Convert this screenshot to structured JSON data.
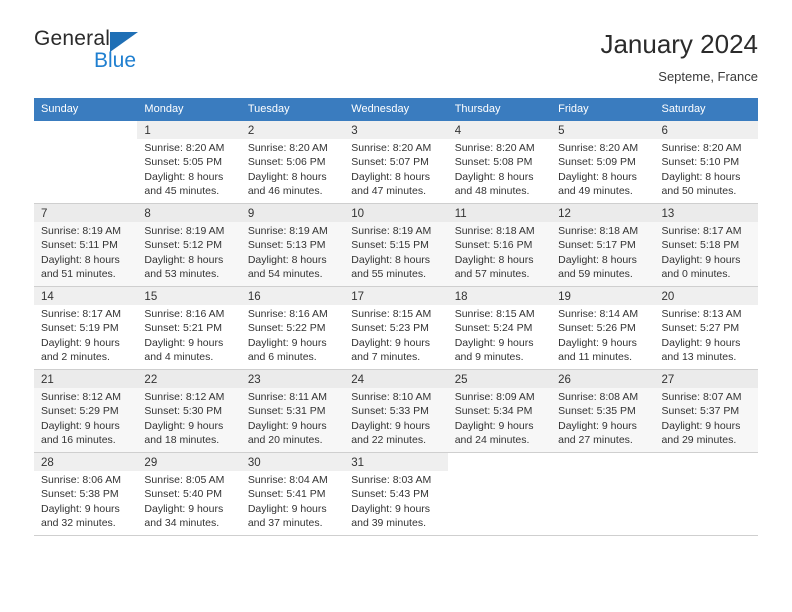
{
  "brand": {
    "name_part1": "General",
    "name_part2": "Blue",
    "accent_color": "#1f7fd0",
    "triangle_color": "#1f6fb5"
  },
  "header": {
    "title": "January 2024",
    "subtitle": "Septeme, France",
    "header_bg_color": "#3a7cbf"
  },
  "weekdays": [
    "Sunday",
    "Monday",
    "Tuesday",
    "Wednesday",
    "Thursday",
    "Friday",
    "Saturday"
  ],
  "weeks": [
    [
      {
        "day": "",
        "l1": "",
        "l2": "",
        "l3": "",
        "l4": ""
      },
      {
        "day": "1",
        "l1": "Sunrise: 8:20 AM",
        "l2": "Sunset: 5:05 PM",
        "l3": "Daylight: 8 hours",
        "l4": "and 45 minutes."
      },
      {
        "day": "2",
        "l1": "Sunrise: 8:20 AM",
        "l2": "Sunset: 5:06 PM",
        "l3": "Daylight: 8 hours",
        "l4": "and 46 minutes."
      },
      {
        "day": "3",
        "l1": "Sunrise: 8:20 AM",
        "l2": "Sunset: 5:07 PM",
        "l3": "Daylight: 8 hours",
        "l4": "and 47 minutes."
      },
      {
        "day": "4",
        "l1": "Sunrise: 8:20 AM",
        "l2": "Sunset: 5:08 PM",
        "l3": "Daylight: 8 hours",
        "l4": "and 48 minutes."
      },
      {
        "day": "5",
        "l1": "Sunrise: 8:20 AM",
        "l2": "Sunset: 5:09 PM",
        "l3": "Daylight: 8 hours",
        "l4": "and 49 minutes."
      },
      {
        "day": "6",
        "l1": "Sunrise: 8:20 AM",
        "l2": "Sunset: 5:10 PM",
        "l3": "Daylight: 8 hours",
        "l4": "and 50 minutes."
      }
    ],
    [
      {
        "day": "7",
        "l1": "Sunrise: 8:19 AM",
        "l2": "Sunset: 5:11 PM",
        "l3": "Daylight: 8 hours",
        "l4": "and 51 minutes."
      },
      {
        "day": "8",
        "l1": "Sunrise: 8:19 AM",
        "l2": "Sunset: 5:12 PM",
        "l3": "Daylight: 8 hours",
        "l4": "and 53 minutes."
      },
      {
        "day": "9",
        "l1": "Sunrise: 8:19 AM",
        "l2": "Sunset: 5:13 PM",
        "l3": "Daylight: 8 hours",
        "l4": "and 54 minutes."
      },
      {
        "day": "10",
        "l1": "Sunrise: 8:19 AM",
        "l2": "Sunset: 5:15 PM",
        "l3": "Daylight: 8 hours",
        "l4": "and 55 minutes."
      },
      {
        "day": "11",
        "l1": "Sunrise: 8:18 AM",
        "l2": "Sunset: 5:16 PM",
        "l3": "Daylight: 8 hours",
        "l4": "and 57 minutes."
      },
      {
        "day": "12",
        "l1": "Sunrise: 8:18 AM",
        "l2": "Sunset: 5:17 PM",
        "l3": "Daylight: 8 hours",
        "l4": "and 59 minutes."
      },
      {
        "day": "13",
        "l1": "Sunrise: 8:17 AM",
        "l2": "Sunset: 5:18 PM",
        "l3": "Daylight: 9 hours",
        "l4": "and 0 minutes."
      }
    ],
    [
      {
        "day": "14",
        "l1": "Sunrise: 8:17 AM",
        "l2": "Sunset: 5:19 PM",
        "l3": "Daylight: 9 hours",
        "l4": "and 2 minutes."
      },
      {
        "day": "15",
        "l1": "Sunrise: 8:16 AM",
        "l2": "Sunset: 5:21 PM",
        "l3": "Daylight: 9 hours",
        "l4": "and 4 minutes."
      },
      {
        "day": "16",
        "l1": "Sunrise: 8:16 AM",
        "l2": "Sunset: 5:22 PM",
        "l3": "Daylight: 9 hours",
        "l4": "and 6 minutes."
      },
      {
        "day": "17",
        "l1": "Sunrise: 8:15 AM",
        "l2": "Sunset: 5:23 PM",
        "l3": "Daylight: 9 hours",
        "l4": "and 7 minutes."
      },
      {
        "day": "18",
        "l1": "Sunrise: 8:15 AM",
        "l2": "Sunset: 5:24 PM",
        "l3": "Daylight: 9 hours",
        "l4": "and 9 minutes."
      },
      {
        "day": "19",
        "l1": "Sunrise: 8:14 AM",
        "l2": "Sunset: 5:26 PM",
        "l3": "Daylight: 9 hours",
        "l4": "and 11 minutes."
      },
      {
        "day": "20",
        "l1": "Sunrise: 8:13 AM",
        "l2": "Sunset: 5:27 PM",
        "l3": "Daylight: 9 hours",
        "l4": "and 13 minutes."
      }
    ],
    [
      {
        "day": "21",
        "l1": "Sunrise: 8:12 AM",
        "l2": "Sunset: 5:29 PM",
        "l3": "Daylight: 9 hours",
        "l4": "and 16 minutes."
      },
      {
        "day": "22",
        "l1": "Sunrise: 8:12 AM",
        "l2": "Sunset: 5:30 PM",
        "l3": "Daylight: 9 hours",
        "l4": "and 18 minutes."
      },
      {
        "day": "23",
        "l1": "Sunrise: 8:11 AM",
        "l2": "Sunset: 5:31 PM",
        "l3": "Daylight: 9 hours",
        "l4": "and 20 minutes."
      },
      {
        "day": "24",
        "l1": "Sunrise: 8:10 AM",
        "l2": "Sunset: 5:33 PM",
        "l3": "Daylight: 9 hours",
        "l4": "and 22 minutes."
      },
      {
        "day": "25",
        "l1": "Sunrise: 8:09 AM",
        "l2": "Sunset: 5:34 PM",
        "l3": "Daylight: 9 hours",
        "l4": "and 24 minutes."
      },
      {
        "day": "26",
        "l1": "Sunrise: 8:08 AM",
        "l2": "Sunset: 5:35 PM",
        "l3": "Daylight: 9 hours",
        "l4": "and 27 minutes."
      },
      {
        "day": "27",
        "l1": "Sunrise: 8:07 AM",
        "l2": "Sunset: 5:37 PM",
        "l3": "Daylight: 9 hours",
        "l4": "and 29 minutes."
      }
    ],
    [
      {
        "day": "28",
        "l1": "Sunrise: 8:06 AM",
        "l2": "Sunset: 5:38 PM",
        "l3": "Daylight: 9 hours",
        "l4": "and 32 minutes."
      },
      {
        "day": "29",
        "l1": "Sunrise: 8:05 AM",
        "l2": "Sunset: 5:40 PM",
        "l3": "Daylight: 9 hours",
        "l4": "and 34 minutes."
      },
      {
        "day": "30",
        "l1": "Sunrise: 8:04 AM",
        "l2": "Sunset: 5:41 PM",
        "l3": "Daylight: 9 hours",
        "l4": "and 37 minutes."
      },
      {
        "day": "31",
        "l1": "Sunrise: 8:03 AM",
        "l2": "Sunset: 5:43 PM",
        "l3": "Daylight: 9 hours",
        "l4": "and 39 minutes."
      },
      {
        "day": "",
        "l1": "",
        "l2": "",
        "l3": "",
        "l4": ""
      },
      {
        "day": "",
        "l1": "",
        "l2": "",
        "l3": "",
        "l4": ""
      },
      {
        "day": "",
        "l1": "",
        "l2": "",
        "l3": "",
        "l4": ""
      }
    ]
  ]
}
